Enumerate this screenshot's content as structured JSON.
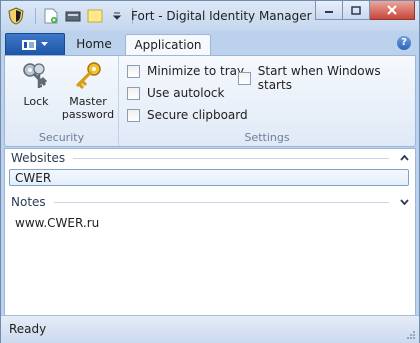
{
  "window": {
    "title": "Fort - Digital Identity Manager"
  },
  "quick_access": {
    "icons": [
      "new-file-icon",
      "save-icon",
      "note-icon",
      "dropdown-icon"
    ]
  },
  "ribbon": {
    "tabs": [
      {
        "label": "Home"
      },
      {
        "label": "Application"
      }
    ],
    "groups": {
      "security": {
        "label": "Security",
        "buttons": [
          {
            "label": "Lock",
            "icon": "keys-icon"
          },
          {
            "label_line1": "Master",
            "label_line2": "password",
            "icon": "key-icon"
          }
        ]
      },
      "settings": {
        "label": "Settings",
        "checkboxes": [
          {
            "label": "Minimize to tray",
            "checked": false
          },
          {
            "label": "Start when Windows starts",
            "checked": false
          },
          {
            "label": "Use autolock",
            "checked": false
          },
          {
            "label": "Secure clipboard",
            "checked": false
          }
        ]
      }
    }
  },
  "content": {
    "websites": {
      "header": "Websites",
      "items": [
        "CWER"
      ]
    },
    "notes": {
      "header": "Notes",
      "text": "www.CWER.ru"
    }
  },
  "status": {
    "text": "Ready"
  },
  "colors": {
    "frame": "#bcd1ec",
    "file_button": "#1d56a7",
    "close_button": "#c8453a"
  }
}
